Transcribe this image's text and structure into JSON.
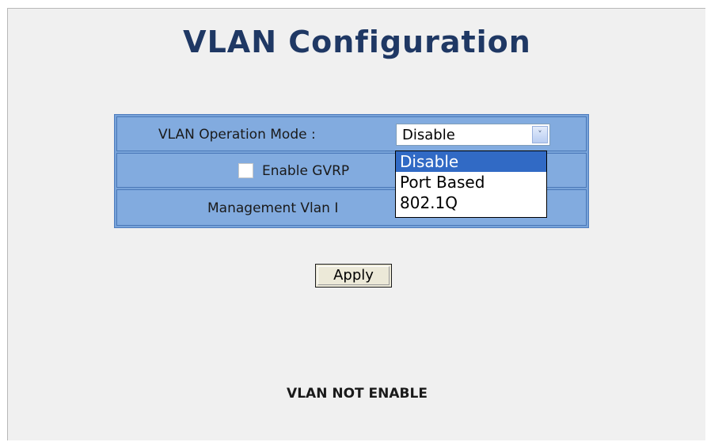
{
  "page": {
    "title": "VLAN Configuration"
  },
  "form": {
    "operation_mode_label": "VLAN Operation Mode :",
    "operation_mode_value": "Disable",
    "operation_mode_options": [
      "Disable",
      "Port Based",
      "802.1Q"
    ],
    "gvrp_label": "Enable GVRP",
    "gvrp_checked": false,
    "management_vlan_label": "Management Vlan I",
    "apply_label": "Apply"
  },
  "status": {
    "message": "VLAN NOT ENABLE"
  },
  "colors": {
    "table_bg": "#78a3d9",
    "title": "#1f3864",
    "selected_option": "#316ac5"
  },
  "icons": {
    "select_arrow": "chevron-down-icon"
  }
}
